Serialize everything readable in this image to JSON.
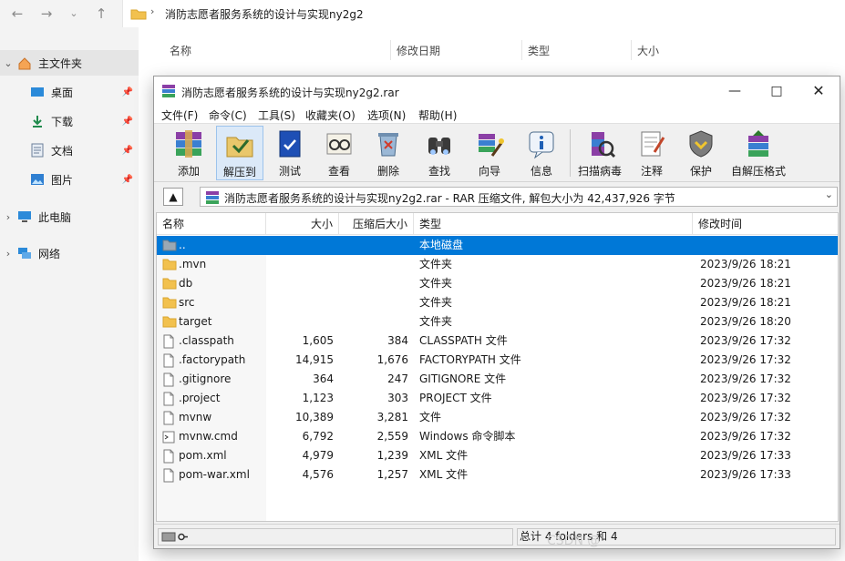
{
  "explorer": {
    "address_text": "消防志愿者服务系统的设计与实现ny2g2",
    "sidebar": [
      {
        "label": "主文件夹",
        "icon": "home-icon"
      },
      {
        "label": "桌面",
        "icon": "desktop-icon"
      },
      {
        "label": "下载",
        "icon": "download-icon"
      },
      {
        "label": "文档",
        "icon": "document-icon"
      },
      {
        "label": "图片",
        "icon": "picture-icon"
      },
      {
        "label": "此电脑",
        "icon": "computer-icon"
      },
      {
        "label": "网络",
        "icon": "network-icon"
      }
    ],
    "columns": [
      "名称",
      "修改日期",
      "类型",
      "大小"
    ]
  },
  "rar": {
    "title": "消防志愿者服务系统的设计与实现ny2g2.rar",
    "menu": [
      "文件(F)",
      "命令(C)",
      "工具(S)",
      "收藏夹(O)",
      "选项(N)",
      "帮助(H)"
    ],
    "toolbar": [
      "添加",
      "解压到",
      "测试",
      "查看",
      "删除",
      "查找",
      "向导",
      "信息",
      "扫描病毒",
      "注释",
      "保护",
      "自解压格式"
    ],
    "path_text": "消防志愿者服务系统的设计与实现ny2g2.rar - RAR 压缩文件, 解包大小为 42,437,926 字节",
    "columns": {
      "name": "名称",
      "size": "大小",
      "packed": "压缩后大小",
      "type": "类型",
      "modified": "修改时间"
    },
    "rows": [
      {
        "name": "..",
        "size": "",
        "packed": "",
        "type": "本地磁盘",
        "modified": "",
        "kind": "drive"
      },
      {
        "name": ".mvn",
        "size": "",
        "packed": "",
        "type": "文件夹",
        "modified": "2023/9/26 18:21",
        "kind": "folder"
      },
      {
        "name": "db",
        "size": "",
        "packed": "",
        "type": "文件夹",
        "modified": "2023/9/26 18:21",
        "kind": "folder"
      },
      {
        "name": "src",
        "size": "",
        "packed": "",
        "type": "文件夹",
        "modified": "2023/9/26 18:21",
        "kind": "folder"
      },
      {
        "name": "target",
        "size": "",
        "packed": "",
        "type": "文件夹",
        "modified": "2023/9/26 18:20",
        "kind": "folder"
      },
      {
        "name": ".classpath",
        "size": "1,605",
        "packed": "384",
        "type": "CLASSPATH 文件",
        "modified": "2023/9/26 17:32",
        "kind": "file"
      },
      {
        "name": ".factorypath",
        "size": "14,915",
        "packed": "1,676",
        "type": "FACTORYPATH 文件",
        "modified": "2023/9/26 17:32",
        "kind": "file"
      },
      {
        "name": ".gitignore",
        "size": "364",
        "packed": "247",
        "type": "GITIGNORE 文件",
        "modified": "2023/9/26 17:32",
        "kind": "file"
      },
      {
        "name": ".project",
        "size": "1,123",
        "packed": "303",
        "type": "PROJECT 文件",
        "modified": "2023/9/26 17:32",
        "kind": "file"
      },
      {
        "name": "mvnw",
        "size": "10,389",
        "packed": "3,281",
        "type": "文件",
        "modified": "2023/9/26 17:32",
        "kind": "file"
      },
      {
        "name": "mvnw.cmd",
        "size": "6,792",
        "packed": "2,559",
        "type": "Windows 命令脚本",
        "modified": "2023/9/26 17:32",
        "kind": "cmd"
      },
      {
        "name": "pom.xml",
        "size": "4,979",
        "packed": "1,239",
        "type": "XML 文件",
        "modified": "2023/9/26 17:33",
        "kind": "file"
      },
      {
        "name": "pom-war.xml",
        "size": "4,576",
        "packed": "1,257",
        "type": "XML 文件",
        "modified": "2023/9/26 17:33",
        "kind": "file"
      }
    ],
    "status": "总计 4 folders 和 4"
  },
  "watermark": "CSDN @",
  "colors": {
    "selection": "#0078d7",
    "folder": "#f2c14e"
  }
}
